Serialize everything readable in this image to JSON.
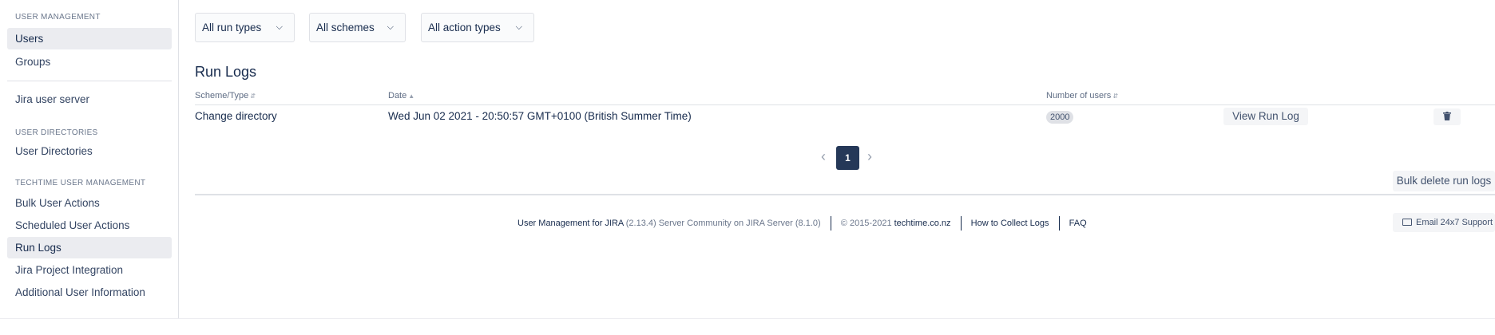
{
  "sidebar": {
    "user_management_title": "USER MANAGEMENT",
    "users": "Users",
    "groups": "Groups",
    "jira_user_server": "Jira user server",
    "user_directories_title": "USER DIRECTORIES",
    "user_directories": "User Directories",
    "techtime_title": "TECHTIME USER MANAGEMENT",
    "bulk_user_actions": "Bulk User Actions",
    "scheduled_user_actions": "Scheduled User Actions",
    "run_logs": "Run Logs",
    "jira_project_integration": "Jira Project Integration",
    "additional_user_information": "Additional User Information"
  },
  "filters": {
    "run_types": "All run types",
    "schemes": "All schemes",
    "action_types": "All action types"
  },
  "page_title": "Run Logs",
  "table": {
    "headers": {
      "scheme_type": "Scheme/Type",
      "date": "Date",
      "number_of_users": "Number of users"
    },
    "rows": [
      {
        "scheme_type": "Change directory",
        "date": "Wed Jun 02 2021 - 20:50:57 GMT+0100 (British Summer Time)",
        "number_of_users": "2000",
        "view_label": "View Run Log"
      }
    ]
  },
  "pagination": {
    "current_page": "1"
  },
  "bulk_delete_label": "Bulk delete run logs",
  "footer": {
    "product": "User Management for JIRA",
    "version": "(2.13.4) Server Community on JIRA Server (8.1.0)",
    "copyright": "© 2015-2021",
    "company": "techtime.co.nz",
    "collect_logs": "How to Collect Logs",
    "faq": "FAQ",
    "email_support": "Email 24x7 Support"
  },
  "icons": {
    "dropdown": "chevron-down-icon",
    "sort": "sort-icon",
    "delete": "trash-icon",
    "prev": "chevron-left-icon",
    "next": "chevron-right-icon",
    "email": "envelope-icon"
  },
  "colors": {
    "active_page": "#253858",
    "active_nav_bg": "#ebecf0",
    "badge_bg": "#dfe1e6"
  }
}
